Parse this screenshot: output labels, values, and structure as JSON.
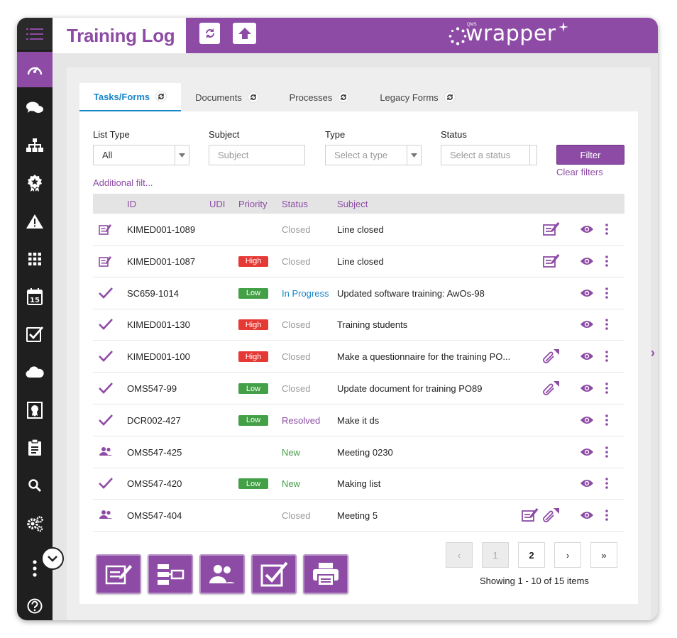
{
  "header": {
    "title": "Training Log",
    "logo_small": "QMS",
    "logo_text": "wrapper"
  },
  "tabs": [
    {
      "label": "Tasks/Forms",
      "active": true
    },
    {
      "label": "Documents"
    },
    {
      "label": "Processes"
    },
    {
      "label": "Legacy Forms"
    }
  ],
  "filters": {
    "list_type": {
      "label": "List Type",
      "value": "All"
    },
    "subject": {
      "label": "Subject",
      "placeholder": "Subject"
    },
    "type": {
      "label": "Type",
      "placeholder": "Select a type"
    },
    "status": {
      "label": "Status",
      "placeholder": "Select a status"
    },
    "filter_button": "Filter",
    "clear_filters": "Clear filters",
    "additional": "Additional filt..."
  },
  "table": {
    "columns": [
      "ID",
      "UDI",
      "Priority",
      "Status",
      "Subject"
    ],
    "rows": [
      {
        "icon": "form-icon",
        "id": "KIMED001-1089",
        "priority": "",
        "status": "Closed",
        "subject": "Line closed",
        "actions": [
          "form"
        ]
      },
      {
        "icon": "form-icon",
        "id": "KIMED001-1087",
        "priority": "High",
        "status": "Closed",
        "subject": "Line closed",
        "actions": [
          "form"
        ]
      },
      {
        "icon": "check-icon",
        "id": "SC659-1014",
        "priority": "Low",
        "status": "In Progress",
        "subject": "Updated software training: AwOs-98",
        "actions": []
      },
      {
        "icon": "check-icon",
        "id": "KIMED001-130",
        "priority": "High",
        "status": "Closed",
        "subject": "Training students",
        "actions": []
      },
      {
        "icon": "check-icon",
        "id": "KIMED001-100",
        "priority": "High",
        "status": "Closed",
        "subject": "Make a questionnaire for the training PO...",
        "actions": [
          "attach"
        ]
      },
      {
        "icon": "check-icon",
        "id": "OMS547-99",
        "priority": "Low",
        "status": "Closed",
        "subject": "Update document for training PO89",
        "actions": [
          "attach"
        ]
      },
      {
        "icon": "check-icon",
        "id": "DCR002-427",
        "priority": "Low",
        "status": "Resolved",
        "subject": "Make it ds",
        "actions": []
      },
      {
        "icon": "users-icon",
        "id": "OMS547-425",
        "priority": "",
        "status": "New",
        "subject": "Meeting 0230",
        "actions": []
      },
      {
        "icon": "check-icon",
        "id": "OMS547-420",
        "priority": "Low",
        "status": "New",
        "subject": "Making list",
        "actions": []
      },
      {
        "icon": "users-icon",
        "id": "OMS547-404",
        "priority": "",
        "status": "Closed",
        "subject": "Meeting 5",
        "actions": [
          "form",
          "attach"
        ]
      }
    ]
  },
  "pagination": {
    "prev": "‹",
    "pages": [
      "1",
      "2"
    ],
    "current": "2",
    "next": "›",
    "last": "»",
    "summary": "Showing 1 - 10 of 15 items"
  },
  "colors": {
    "brand": "#8d4ba5",
    "high": "#e53935",
    "low": "#43a047",
    "in_progress": "#1a86c8",
    "resolved": "#8d4ba5",
    "new": "#43a047",
    "closed": "#999999"
  }
}
